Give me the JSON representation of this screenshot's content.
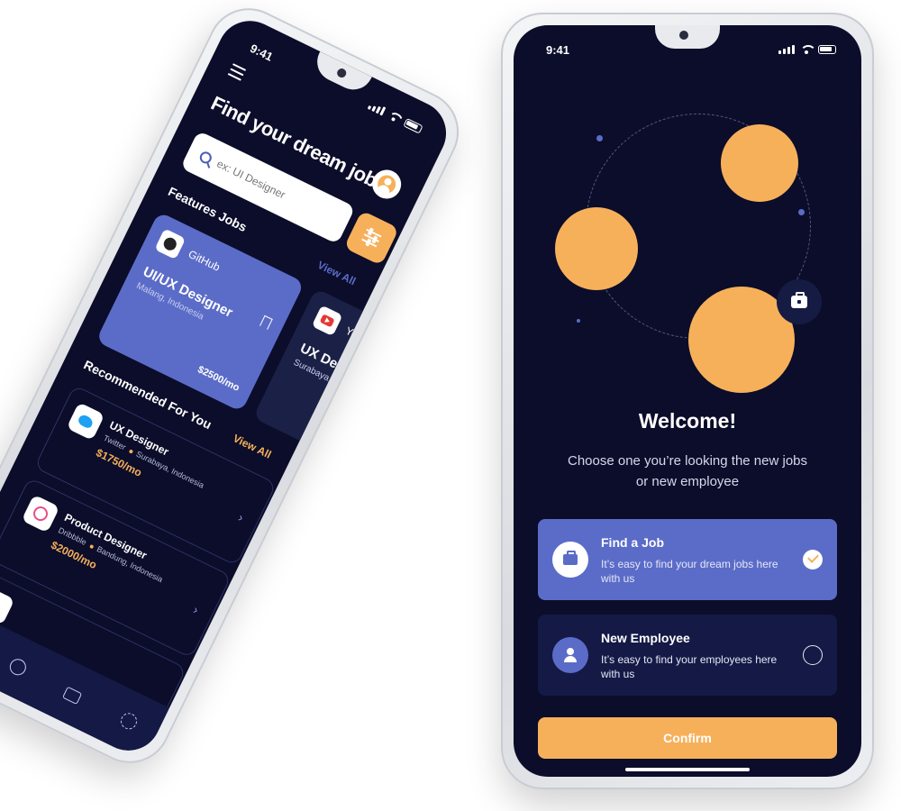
{
  "left_phone": {
    "status_time": "9:41",
    "title": "Find your dream job!",
    "search": {
      "placeholder": "ex: UI Designer"
    },
    "featured": {
      "heading": "Features Jobs",
      "view_all": "View All",
      "jobs": [
        {
          "company": "GitHub",
          "title": "UI/UX Designer",
          "location": "Malang, Indonesia",
          "salary": "$2500/mo"
        },
        {
          "company": "Youtu",
          "title": "UX Desig",
          "location": "Surabaya, Ind"
        }
      ]
    },
    "recommended": {
      "heading": "Recommended For You",
      "view_all": "View All",
      "jobs": [
        {
          "title": "UX Designer",
          "company": "Twitter",
          "location": "Surabaya, Indonesia",
          "salary": "$1750/mo"
        },
        {
          "title": "Product Designer",
          "company": "Dribbble",
          "location": "Bandung, Indonesia",
          "salary": "$2000/mo"
        }
      ]
    },
    "nav_icons": [
      "home-icon",
      "compass-icon",
      "briefcase-icon",
      "gear-icon"
    ]
  },
  "right_phone": {
    "status_time": "9:41",
    "welcome_title": "Welcome!",
    "welcome_subtitle": "Choose one you’re looking the new jobs or new employee",
    "options": [
      {
        "title": "Find a Job",
        "description": "It’s easy to find your dream jobs here with us",
        "selected": true
      },
      {
        "title": "New Employee",
        "description": "It’s easy to find your employees here with us",
        "selected": false
      }
    ],
    "confirm_label": "Confirm"
  },
  "colors": {
    "background": "#0b0d2a",
    "accent_orange": "#f7b05a",
    "accent_blue": "#5b6cc8",
    "card_dark": "#141a45"
  }
}
